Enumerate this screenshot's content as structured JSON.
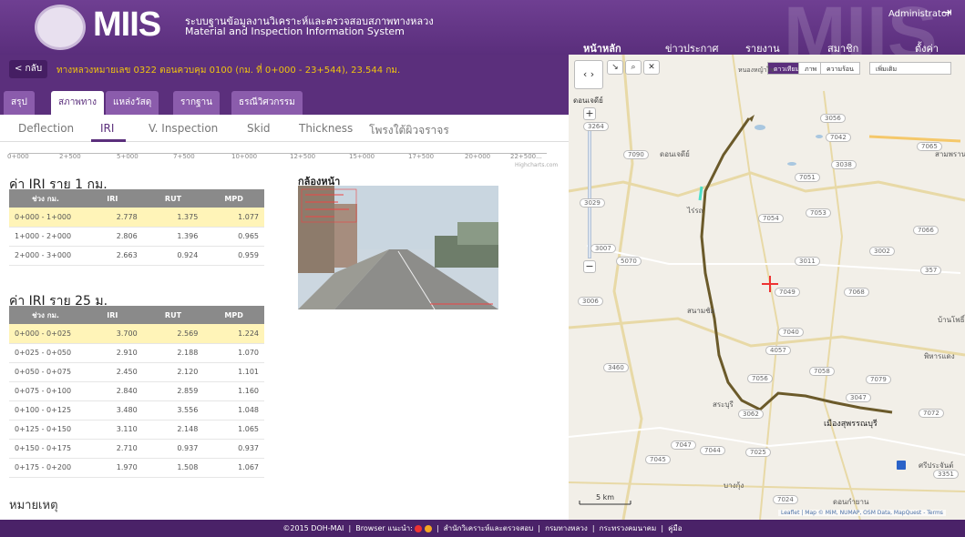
{
  "header": {
    "brand": "MIIS",
    "subtitle_th": "ระบบฐานข้อมูลงานวิเคราะห์และตรวจสอบสภาพทางหลวง",
    "subtitle_en": "Material and Inspection Information System",
    "user": "Administrator",
    "nav": [
      "หน้าหลัก",
      "ข่าวประกาศ",
      "รายงาน",
      "สมาชิก",
      "ตั้งค่า"
    ]
  },
  "title_bar": {
    "back_label": "< กลับ",
    "title": "ทางหลวงหมายเลข 0322 ตอนควบคุม 0100 (กม. ที่ 0+000 - 23+544), 23.544 กม."
  },
  "tabs_main": [
    "สรุป",
    "สภาพทาง",
    "แหล่งวัสดุ",
    "รากฐาน",
    "ธรณีวิศวกรรม"
  ],
  "tabs_sub": [
    "Deflection",
    "IRI",
    "V. Inspection",
    "Skid",
    "Thickness",
    "โพรงใต้ผิวจราจร"
  ],
  "axis_ticks": [
    "0+000",
    "2+500",
    "5+000",
    "7+500",
    "10+000",
    "12+500",
    "15+000",
    "17+500",
    "20+000",
    "22+500..."
  ],
  "highcharts": "Highcharts.com",
  "iri_1km": {
    "heading": "ค่า IRI ราย 1 กม.",
    "columns": [
      "ช่วง กม.",
      "IRI",
      "RUT",
      "MPD"
    ],
    "rows": [
      [
        "0+000 - 1+000",
        "2.778",
        "1.375",
        "1.077"
      ],
      [
        "1+000 - 2+000",
        "2.806",
        "1.396",
        "0.965"
      ],
      [
        "2+000 - 3+000",
        "2.663",
        "0.924",
        "0.959"
      ]
    ]
  },
  "iri_25m": {
    "heading": "ค่า IRI ราย 25 ม.",
    "columns": [
      "ช่วง กม.",
      "IRI",
      "RUT",
      "MPD"
    ],
    "rows": [
      [
        "0+000 - 0+025",
        "3.700",
        "2.569",
        "1.224"
      ],
      [
        "0+025 - 0+050",
        "2.910",
        "2.188",
        "1.070"
      ],
      [
        "0+050 - 0+075",
        "2.450",
        "2.120",
        "1.101"
      ],
      [
        "0+075 - 0+100",
        "2.840",
        "2.859",
        "1.160"
      ],
      [
        "0+100 - 0+125",
        "3.480",
        "3.556",
        "1.048"
      ],
      [
        "0+125 - 0+150",
        "3.110",
        "2.148",
        "1.065"
      ],
      [
        "0+150 - 0+175",
        "2.710",
        "0.937",
        "0.937"
      ],
      [
        "0+175 - 0+200",
        "1.970",
        "1.508",
        "1.067"
      ]
    ]
  },
  "camera_label": "กล้องหน้า",
  "remark_label": "หมายเหตุ",
  "map": {
    "types": [
      "ดาวเทียม",
      "ภาพ",
      "ความร้อน",
      "เพิ่มเติม"
    ],
    "places": [
      "ดอนเจดีย์",
      "ไร่รถ",
      "สนามชัย",
      "ดอนเจดีย์",
      "สามพราน",
      "บ้านโพธิ์",
      "พิหารแดง",
      "สระบุรี",
      "เมืองสุพรรณบุรี",
      "บางกุ้ง",
      "ดอนกำยาน",
      "ศรีประจันต์",
      "หนองหญ้าไซ"
    ],
    "roads": [
      "3264",
      "3056",
      "7042",
      "7065",
      "7090",
      "3038",
      "7051",
      "3029",
      "7054",
      "7053",
      "7066",
      "3007",
      "5070",
      "3002",
      "3011",
      "357",
      "7068",
      "3006",
      "7049",
      "7040",
      "4057",
      "7058",
      "3460",
      "7056",
      "3047",
      "7079",
      "3062",
      "7072",
      "7047",
      "7044",
      "7025",
      "7045",
      "3351",
      "7024"
    ],
    "scale": "5 km",
    "attribution": "Leaflet | Map © MiM, NUMAP, OSM Data, MapQuest - Terms"
  },
  "footer": {
    "copyright": "©2015 DOH-MAI",
    "browser": "Browser แนะนำ:",
    "links": [
      "สำนักวิเคราะห์และตรวจสอบ",
      "กรมทางหลวง",
      "กระทรวงคมนาคม",
      "คู่มือ"
    ]
  },
  "colors": {
    "purple": "#5b2f7c",
    "highlight": "#fff4b8",
    "route": "#6b5a2a",
    "gold": "#f1c40f"
  }
}
